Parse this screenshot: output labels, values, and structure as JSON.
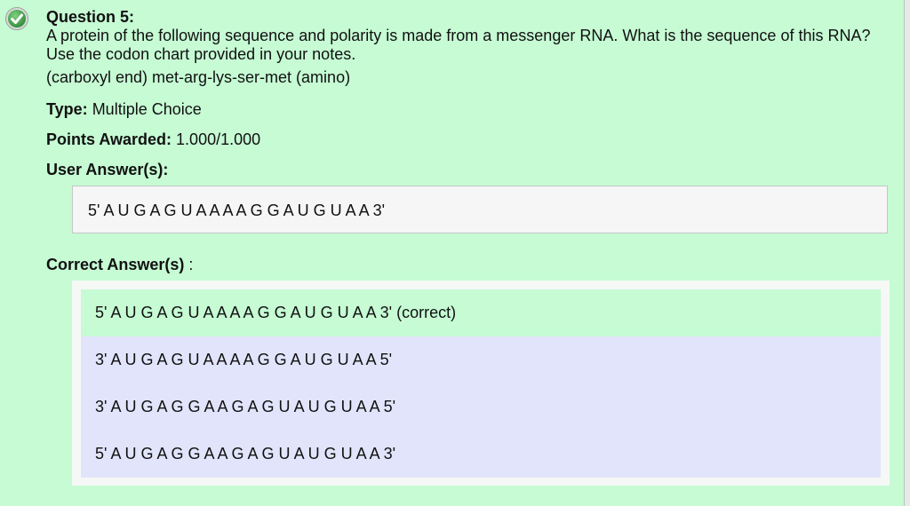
{
  "question": {
    "title": "Question 5:",
    "text": "A protein of the following sequence and polarity is made from a messenger RNA. What is the sequence of this RNA? Use the codon chart provided in your notes.",
    "sequence": "(carboxyl end) met-arg-lys-ser-met (amino)"
  },
  "status": {
    "icon": "check-circle-icon",
    "color": "#3f9e49"
  },
  "meta": {
    "type_label": "Type:",
    "type_value": "Multiple Choice",
    "points_label": "Points Awarded:",
    "points_value": "1.000/1.000",
    "user_answers_label": "User Answer(s):",
    "correct_answers_label": "Correct Answer(s)",
    "correct_answers_suffix": ":"
  },
  "user_answer": "5' A U G A G U A A A A G G A U G U A A 3'",
  "options": [
    {
      "text": "5' A U G A G U A A A A G G A U G U A A 3' (correct)",
      "is_correct": true
    },
    {
      "text": "3' A U G A G U A A A A G G A U G U A A 5'",
      "is_correct": false
    },
    {
      "text": "3' A U G A G G A A G A G U A U G U A A 5'",
      "is_correct": false
    },
    {
      "text": "5' A U G A G G A A G A G U A U G U A A 3'",
      "is_correct": false
    }
  ],
  "colors": {
    "background": "#c6fbd4",
    "option_background": "#e2e4fb",
    "correct_option_background": "#c6fbd4",
    "answer_box_background": "#f5f6f5"
  }
}
